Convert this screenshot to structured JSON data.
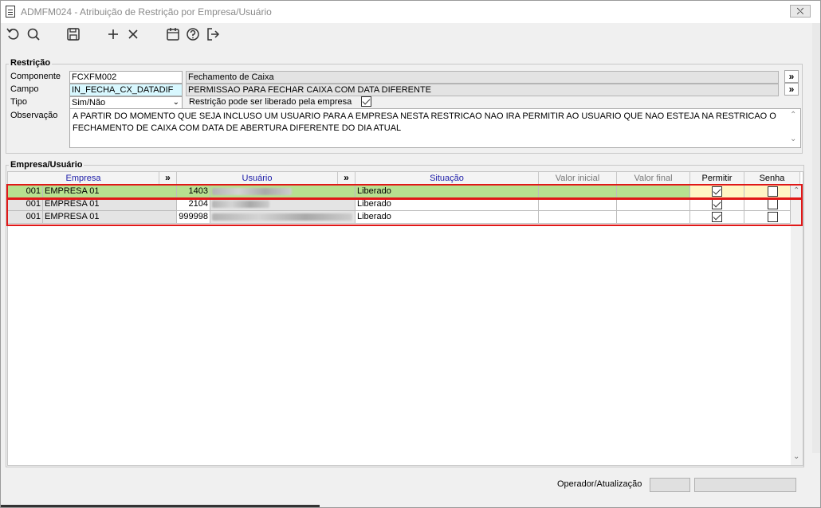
{
  "window": {
    "title": "ADMFM024 - Atribuição de Restrição por Empresa/Usuário",
    "close_label": "⛌"
  },
  "toolbar": {
    "icons": [
      "refresh-icon",
      "search-icon",
      "save-icon",
      "add-icon",
      "delete-icon",
      "calendar-icon",
      "help-icon",
      "exit-icon"
    ]
  },
  "restricao": {
    "legend": "Restrição",
    "componente_label": "Componente",
    "componente_value": "FCXFM002",
    "componente_desc": "Fechamento de Caixa",
    "campo_label": "Campo",
    "campo_value": "IN_FECHA_CX_DATADIF",
    "campo_desc": "PERMISSAO PARA FECHAR CAIXA COM DATA DIFERENTE",
    "tipo_label": "Tipo",
    "tipo_value": "Sim/Não",
    "liberado_label": "Restrição pode ser liberado pela empresa",
    "liberado_checked": true,
    "observacao_label": "Observação",
    "observacao_value": "A PARTIR DO MOMENTO QUE SEJA INCLUSO UM USUARIO PARA A EMPRESA NESTA RESTRICAO NAO IRA PERMITIR AO USUARIO QUE NAO ESTEJA NA RESTRICAO O FECHAMENTO DE CAIXA COM DATA DE ABERTURA DIFERENTE DO DIA ATUAL",
    "more_label": "»"
  },
  "grid": {
    "legend": "Empresa/Usuário",
    "headers": {
      "empresa": "Empresa",
      "usuario": "Usuário",
      "situacao": "Situação",
      "valor_inicial": "Valor inicial",
      "valor_final": "Valor final",
      "permitir": "Permitir",
      "senha": "Senha",
      "sort": "»"
    },
    "rows": [
      {
        "emp_code": "001",
        "emp_name": "EMPRESA 01",
        "user_code": "1403",
        "situacao": "Liberado",
        "permitir": true,
        "senha": false
      },
      {
        "emp_code": "001",
        "emp_name": "EMPRESA 01",
        "user_code": "2104",
        "situacao": "Liberado",
        "permitir": true,
        "senha": false
      },
      {
        "emp_code": "001",
        "emp_name": "EMPRESA 01",
        "user_code": "999998",
        "situacao": "Liberado",
        "permitir": true,
        "senha": false
      }
    ]
  },
  "footer": {
    "operador_label": "Operador/Atualização"
  },
  "colors": {
    "selected_row": "#b7e090",
    "highlight": "#e01818",
    "link_blue": "#1c1ca8"
  }
}
